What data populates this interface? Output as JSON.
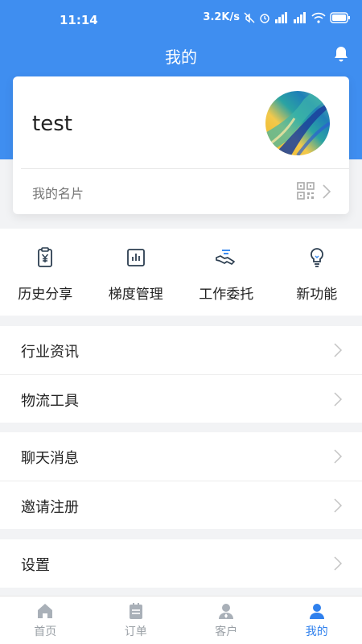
{
  "status_bar": {
    "time": "11:14",
    "network_speed": "3.2K/s",
    "battery": "full"
  },
  "header": {
    "title": "我的"
  },
  "profile": {
    "username": "test",
    "card_label": "我的名片"
  },
  "features": [
    {
      "label": "历史分享",
      "icon": "receipt-yen-icon"
    },
    {
      "label": "梯度管理",
      "icon": "bar-chart-icon"
    },
    {
      "label": "工作委托",
      "icon": "handshake-icon"
    },
    {
      "label": "新功能",
      "icon": "lightbulb-icon"
    }
  ],
  "menu_groups": [
    {
      "items": [
        {
          "label": "行业资讯"
        },
        {
          "label": "物流工具"
        }
      ]
    },
    {
      "items": [
        {
          "label": "聊天消息"
        },
        {
          "label": "邀请注册"
        }
      ]
    },
    {
      "items": [
        {
          "label": "设置"
        }
      ]
    }
  ],
  "tabs": [
    {
      "label": "首页",
      "icon": "home-icon",
      "active": false
    },
    {
      "label": "订单",
      "icon": "order-icon",
      "active": false
    },
    {
      "label": "客户",
      "icon": "customer-icon",
      "active": false
    },
    {
      "label": "我的",
      "icon": "person-icon",
      "active": true
    }
  ],
  "colors": {
    "primary": "#3f8ef0",
    "active_tab": "#2f80ed",
    "inactive_tab": "#9aa0a6"
  }
}
